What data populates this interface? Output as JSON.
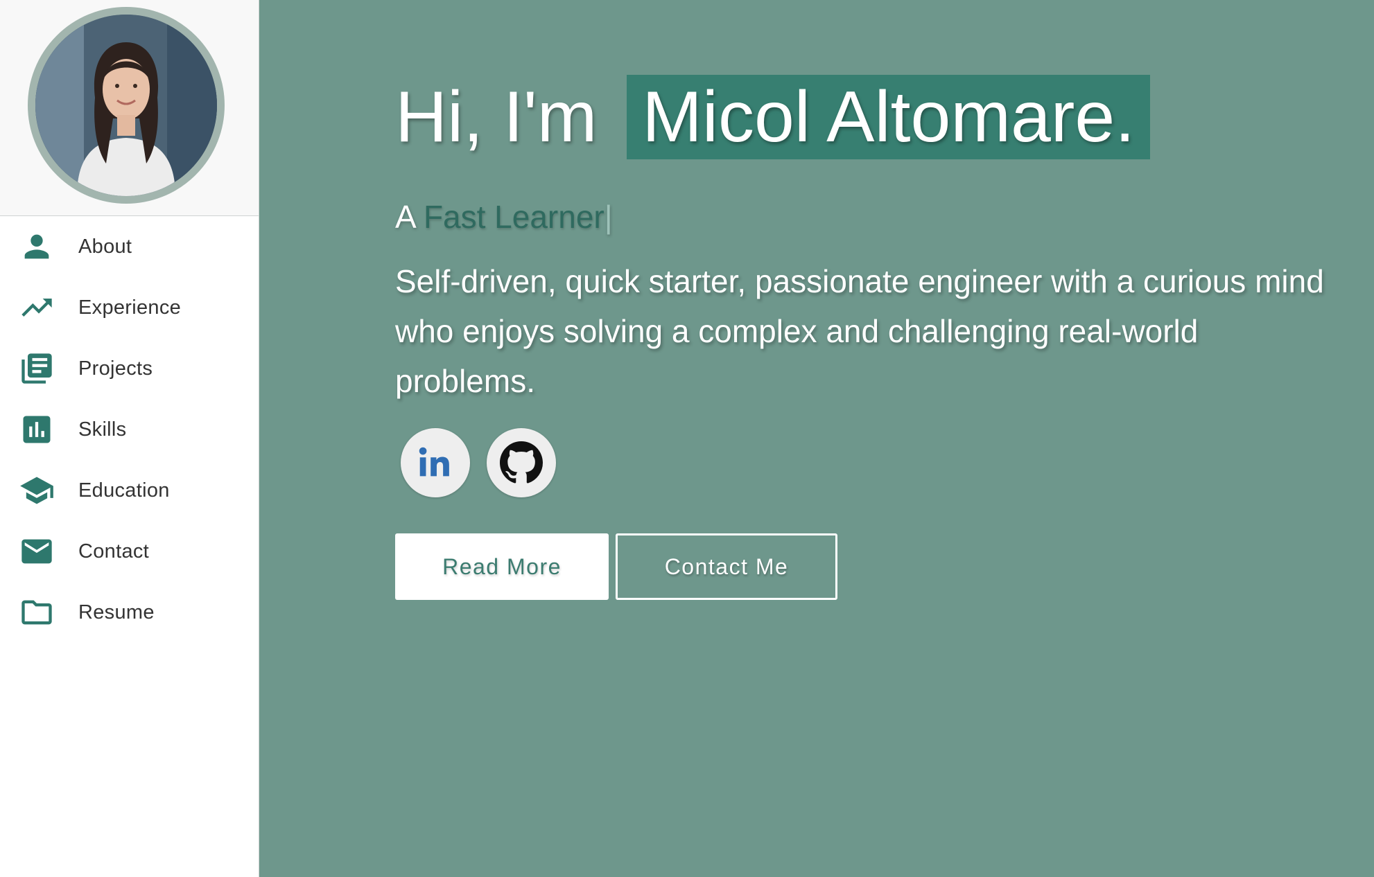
{
  "sidebar": {
    "profile": {
      "avatar_alt": "profile photo"
    },
    "items": [
      {
        "label": "About",
        "icon": "person-icon"
      },
      {
        "label": "Experience",
        "icon": "trending-up-icon"
      },
      {
        "label": "Projects",
        "icon": "library-books-icon"
      },
      {
        "label": "Skills",
        "icon": "bar-chart-icon"
      },
      {
        "label": "Education",
        "icon": "graduation-cap-icon"
      },
      {
        "label": "Contact",
        "icon": "mail-icon"
      },
      {
        "label": "Resume",
        "icon": "folder-icon"
      }
    ]
  },
  "hero": {
    "greeting_prefix": "Hi, I'm",
    "name": "Micol Altomare.",
    "tagline_prefix": "A",
    "tagline_typed": "Fast Learner",
    "tagline_cursor": "|",
    "summary": "Self-driven, quick starter, passionate engineer with a curious mind who enjoys solving a complex and challenging real-world problems.",
    "socials": [
      {
        "name": "LinkedIn",
        "icon": "linkedin-icon"
      },
      {
        "name": "GitHub",
        "icon": "github-icon"
      }
    ],
    "buttons": {
      "read_more": "Read More",
      "contact_me": "Contact Me"
    }
  },
  "colors": {
    "accent": "#2e786d",
    "main_background": "#6e978c",
    "name_highlight": "#377f71",
    "avatar_ring": "#a2b5ae"
  }
}
